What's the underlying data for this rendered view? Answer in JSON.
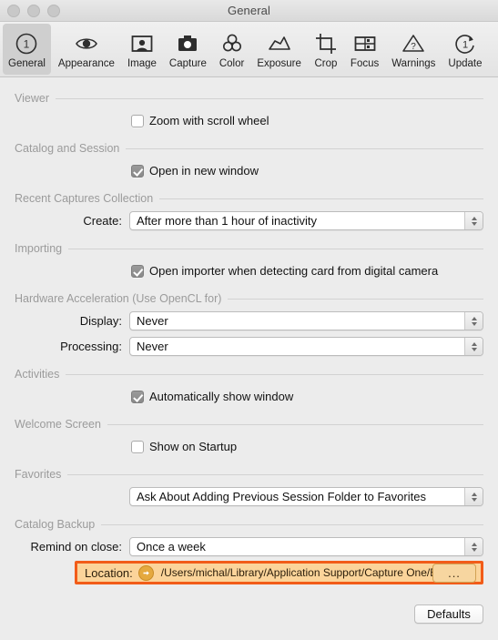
{
  "window": {
    "title": "General",
    "traffic_lights": [
      "close-button",
      "minimize-button",
      "zoom-button"
    ]
  },
  "toolbar": {
    "items": [
      {
        "label": "General",
        "icon": "circle-one-icon",
        "selected": true
      },
      {
        "label": "Appearance",
        "icon": "eye-icon",
        "selected": false
      },
      {
        "label": "Image",
        "icon": "portrait-frame-icon",
        "selected": false
      },
      {
        "label": "Capture",
        "icon": "camera-icon",
        "selected": false
      },
      {
        "label": "Color",
        "icon": "three-circles-icon",
        "selected": false
      },
      {
        "label": "Exposure",
        "icon": "curve-icon",
        "selected": false
      },
      {
        "label": "Crop",
        "icon": "crop-icon",
        "selected": false
      },
      {
        "label": "Focus",
        "icon": "focus-grid-icon",
        "selected": false
      },
      {
        "label": "Warnings",
        "icon": "warning-triangle-icon",
        "selected": false
      },
      {
        "label": "Update",
        "icon": "refresh-one-icon",
        "selected": false
      }
    ]
  },
  "sections": {
    "viewer": {
      "title": "Viewer",
      "zoom_scroll": {
        "label": "Zoom with scroll wheel",
        "checked": false
      }
    },
    "catalog_session": {
      "title": "Catalog and Session",
      "open_new_window": {
        "label": "Open in new window",
        "checked": true
      }
    },
    "recent_captures": {
      "title": "Recent Captures Collection",
      "create": {
        "label": "Create:",
        "value": "After more than 1 hour of inactivity"
      }
    },
    "importing": {
      "title": "Importing",
      "open_importer": {
        "label": "Open importer when detecting card from digital camera",
        "checked": true
      }
    },
    "hardware_acceleration": {
      "title": "Hardware Acceleration (Use OpenCL for)",
      "display": {
        "label": "Display:",
        "value": "Never"
      },
      "processing": {
        "label": "Processing:",
        "value": "Never"
      }
    },
    "activities": {
      "title": "Activities",
      "auto_show": {
        "label": "Automatically show window",
        "checked": true
      }
    },
    "welcome_screen": {
      "title": "Welcome Screen",
      "show_startup": {
        "label": "Show on Startup",
        "checked": false
      }
    },
    "favorites": {
      "title": "Favorites",
      "ask": {
        "value": "Ask About Adding Previous Session Folder to Favorites"
      }
    },
    "catalog_backup": {
      "title": "Catalog Backup",
      "remind": {
        "label": "Remind on close:",
        "value": "Once a week"
      },
      "location": {
        "label": "Location:",
        "path": "/Users/michal/Library/Application Support/Capture One/Back",
        "browse_label": "...",
        "arrow_icon": "arrow-right-circle-icon",
        "highlight_border": "#f25c19",
        "highlight_fill": "#fbd49a"
      }
    }
  },
  "footer": {
    "defaults_label": "Defaults"
  }
}
